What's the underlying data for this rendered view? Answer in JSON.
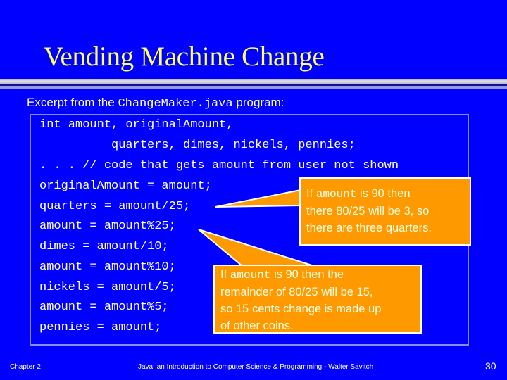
{
  "slide": {
    "title": "Vending Machine Change",
    "intro": {
      "prefix": "Excerpt from the ",
      "filename": "ChangeMaker.java",
      "suffix": " program:"
    },
    "code_lines": [
      "int amount, originalAmount,",
      "          quarters, dimes, nickels, pennies;",
      ". . . // code that gets amount from user not shown",
      "originalAmount = amount;",
      "quarters = amount/25;",
      "amount = amount%25;",
      "dimes = amount/10;",
      "amount = amount%10;",
      "nickels = amount/5;",
      "amount = amount%5;",
      "pennies = amount;"
    ],
    "callouts": [
      {
        "lead": "If ",
        "code": "amount",
        "line1_rest": " is 90 then",
        "line2": "there 80/25 will be 3, so",
        "line3": "there are three quarters."
      },
      {
        "lead": "If ",
        "code": "amount",
        "line1_rest": " is 90 then the",
        "line2": "remainder of 80/25 will be 15,",
        "line3": "so 15 cents change is made up",
        "line4": "of other coins."
      }
    ],
    "colors": {
      "background": "#0000ff",
      "title": "#ffff66",
      "callout": "#ff9900",
      "text": "#ffffff"
    }
  },
  "footer": {
    "chapter": "Chapter 2",
    "book": "Java: an Introduction to Computer Science & Programming - Walter Savitch",
    "page_number": "30"
  }
}
